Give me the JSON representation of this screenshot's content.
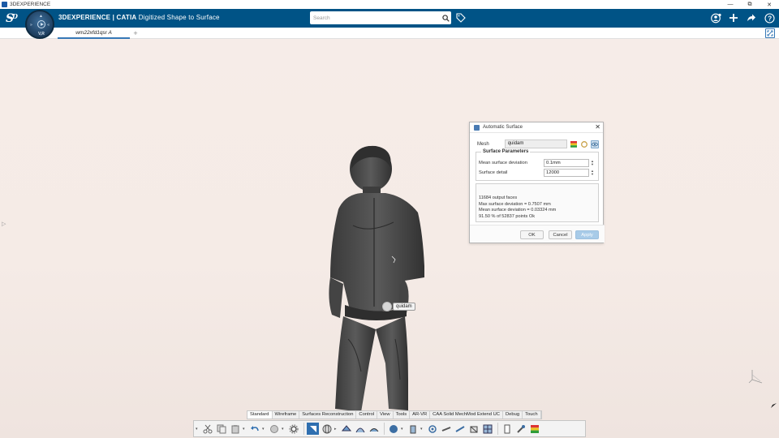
{
  "window": {
    "title": "3DEXPERIENCE",
    "controls": [
      "—",
      "⧉",
      "✕"
    ]
  },
  "header": {
    "brand_bold": "3D",
    "brand_rest": "EXPERIENCE | CATIA",
    "app_name": "Digitized Shape to Surface",
    "search_placeholder": "Search",
    "accent_color": "#005386"
  },
  "compass": {
    "label": "V,R"
  },
  "tabs": [
    {
      "label": "wm22xfd1qsr A",
      "active": true
    }
  ],
  "viewport": {
    "mesh_tag": "quidam"
  },
  "dialog": {
    "title": "Automatic Surface",
    "mesh_label": "Mesh",
    "mesh_value": "quidam",
    "params_title": "Surface Parameters",
    "mean_dev_label": "Mean surface deviation",
    "mean_dev_value": "0.1mm",
    "detail_label": "Surface detail",
    "detail_value": "12000",
    "results": [
      "11684 output faces",
      "Max surface deviation = 0.7507 mm",
      "Mean surface deviation = 0.03324 mm",
      "91.50 % of 52837 points Ok"
    ],
    "ok_label": "OK",
    "cancel_label": "Cancel",
    "apply_label": "Apply"
  },
  "action_bar": {
    "tabs": [
      "Standard",
      "Wireframe",
      "Surfaces Reconstruction",
      "Control",
      "View",
      "Tools",
      "AR-VR",
      "CAA Solid MechMod Extend UC",
      "Debug",
      "Touch"
    ],
    "active_tab": "Standard",
    "tools": [
      "cut-icon",
      "copy-icon",
      "paste-icon",
      "undo-icon",
      "update-icon",
      "settings-gear-icon",
      "select-icon",
      "sphere-icon",
      "mesh-icon",
      "curve-icon",
      "grid-icon",
      "surface-icon",
      "shape-icon",
      "scan-icon",
      "fit-icon",
      "measure-icon",
      "box-icon",
      "analysis-icon",
      "color-map-icon"
    ]
  }
}
